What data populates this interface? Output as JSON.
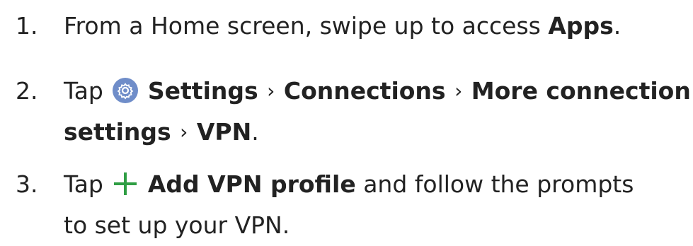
{
  "steps": [
    {
      "number": "1.",
      "prefix": "From a Home screen, swipe up to access ",
      "apps": "Apps",
      "suffix": "."
    },
    {
      "number": "2.",
      "tap": "Tap",
      "icon": "settings-gear-icon",
      "settings": "Settings",
      "sep": "›",
      "connections": "Connections",
      "more": "More connection",
      "more_cont": "settings",
      "vpn": "VPN",
      "suffix": "."
    },
    {
      "number": "3.",
      "tap": "Tap",
      "icon": "plus-icon",
      "add": "Add VPN profile",
      "rest": " and follow the prompts",
      "line2": "to set up your VPN."
    }
  ],
  "colors": {
    "text": "#222222",
    "icon_bg": "#6f8dc9",
    "plus": "#2f9e44"
  }
}
